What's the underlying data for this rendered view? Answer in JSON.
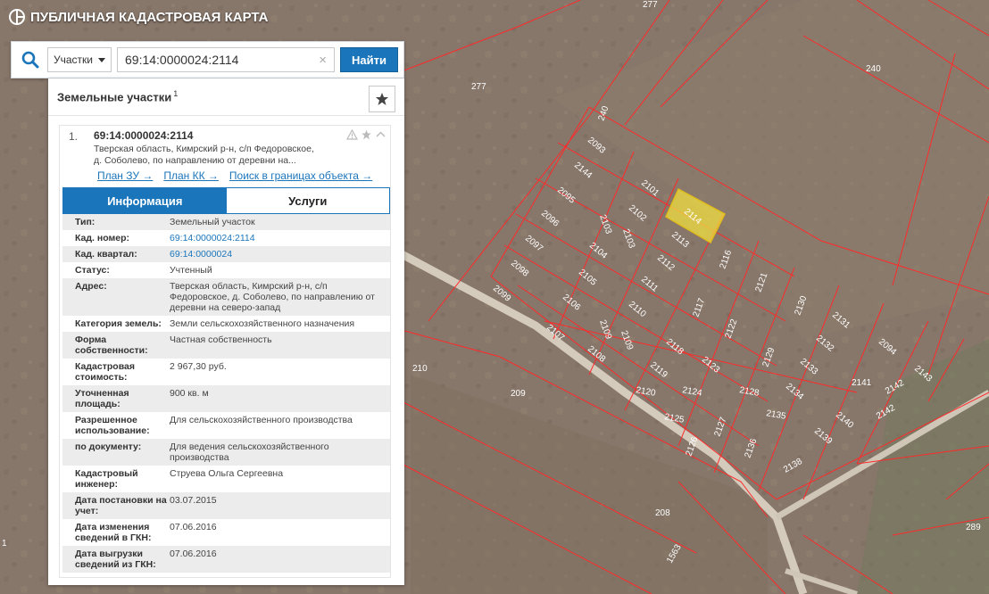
{
  "app": {
    "title": "ПУБЛИЧНАЯ КАДАСТРОВАЯ КАРТА"
  },
  "search": {
    "type_label": "Участки",
    "query": "69:14:0000024:2114",
    "clear_label": "×",
    "submit_label": "Найти"
  },
  "panel": {
    "title": "Земельные участки",
    "count": "1"
  },
  "result": {
    "index": "1.",
    "cad_number": "69:14:0000024:2114",
    "address_short_1": "Тверская область, Кимрский р-н, с/п Федоровское,",
    "address_short_2": "д. Соболево, по направлению от деревни на...",
    "links": {
      "plan_zu": "План ЗУ →",
      "plan_kk": "План КК →",
      "search_bounds": "Поиск в границах объекта →"
    }
  },
  "tabs": {
    "info": "Информация",
    "services": "Услуги"
  },
  "info": [
    {
      "label": "Тип:",
      "value": "Земельный участок"
    },
    {
      "label": "Кад. номер:",
      "value": "69:14:0000024:2114"
    },
    {
      "label": "Кад. квартал:",
      "value": "69:14:0000024"
    },
    {
      "label": "Статус:",
      "value": "Учтенный"
    },
    {
      "label": "Адрес:",
      "value": "Тверская область, Кимрский р-н, с/п Федоровское, д. Соболево, по направлению от деревни на северо-запад"
    },
    {
      "label": "Категория земель:",
      "value": "Земли сельскохозяйственного назначения"
    },
    {
      "label": "Форма собственности:",
      "value": "Частная собственность"
    },
    {
      "label": "Кадастровая стоимость:",
      "value": "2 967,30 руб."
    },
    {
      "label": "Уточненная площадь:",
      "value": "900 кв. м"
    },
    {
      "label": "Разрешенное использование:",
      "value": "Для сельскохозяйственного производства"
    },
    {
      "label": "по документу:",
      "value": "Для ведения сельскохозяйственного производства"
    },
    {
      "label": "Кадастровый инженер:",
      "value": "Струева Ольга Сергеевна"
    },
    {
      "label": "Дата постановки на учет:",
      "value": "03.07.2015"
    },
    {
      "label": "Дата изменения сведений в ГКН:",
      "value": "07.06.2016"
    },
    {
      "label": "Дата выгрузки сведений из ГКН:",
      "value": "07.06.2016"
    }
  ],
  "map": {
    "parcel_labels": [
      "277",
      "240",
      "277",
      "240",
      "2093",
      "2144",
      "2095",
      "2096",
      "2097",
      "2098",
      "2099",
      "2101",
      "2102",
      "2103",
      "2104",
      "2105",
      "2106",
      "2107",
      "2108",
      "2109",
      "2103",
      "2111",
      "2112",
      "2113",
      "2114",
      "2116",
      "2121",
      "2117",
      "2122",
      "2110",
      "2109",
      "2118",
      "2119",
      "2123",
      "2120",
      "2124",
      "2125",
      "2127",
      "2128",
      "2129",
      "2130",
      "2131",
      "2132",
      "2133",
      "2134",
      "2135",
      "2136",
      "2126",
      "2138",
      "2139",
      "2140",
      "2141",
      "2142",
      "2142",
      "2143",
      "2094",
      "210",
      "209",
      "208",
      "1563",
      "289",
      "1"
    ],
    "colors": {
      "boundary": "#ff2a2a",
      "selected_fill": "#f0e040",
      "road": "#d9d2c6",
      "terrain": "#857364"
    }
  },
  "colors": {
    "accent": "#1b75bb"
  }
}
